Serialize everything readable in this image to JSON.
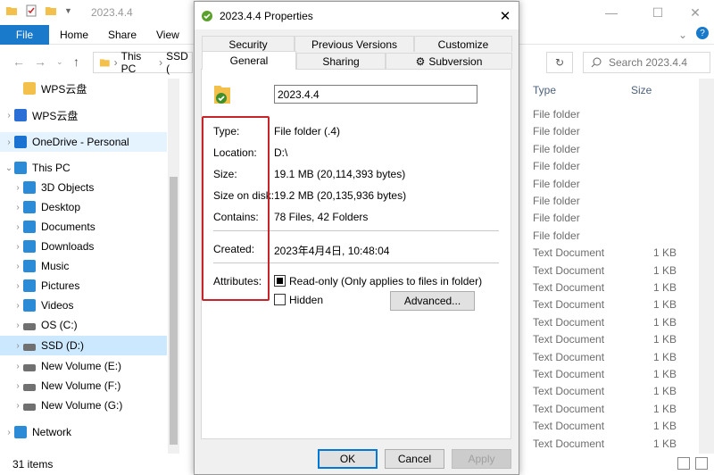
{
  "explorer": {
    "title": "2023.4.4",
    "ribbon_tabs": [
      "File",
      "Home",
      "Share",
      "View"
    ],
    "address": {
      "this_pc": "This PC",
      "crumb": "SSD ("
    },
    "search_placeholder": "Search 2023.4.4",
    "nav": [
      {
        "label": "WPS云盘",
        "indent": 1,
        "chevron": ""
      },
      {
        "label": "WPS云盘",
        "indent": 0,
        "chevron": ">"
      },
      {
        "label": "OneDrive - Personal",
        "indent": 0,
        "chevron": ">"
      },
      {
        "label": "This PC",
        "indent": 0,
        "chevron": "v"
      },
      {
        "label": "3D Objects",
        "indent": 1,
        "chevron": ">"
      },
      {
        "label": "Desktop",
        "indent": 1,
        "chevron": ">"
      },
      {
        "label": "Documents",
        "indent": 1,
        "chevron": ">"
      },
      {
        "label": "Downloads",
        "indent": 1,
        "chevron": ">"
      },
      {
        "label": "Music",
        "indent": 1,
        "chevron": ">"
      },
      {
        "label": "Pictures",
        "indent": 1,
        "chevron": ">"
      },
      {
        "label": "Videos",
        "indent": 1,
        "chevron": ">"
      },
      {
        "label": "OS (C:)",
        "indent": 1,
        "chevron": ">"
      },
      {
        "label": "SSD (D:)",
        "indent": 1,
        "chevron": ">"
      },
      {
        "label": "New Volume (E:)",
        "indent": 1,
        "chevron": ">"
      },
      {
        "label": "New Volume (F:)",
        "indent": 1,
        "chevron": ">"
      },
      {
        "label": "New Volume (G:)",
        "indent": 1,
        "chevron": ">"
      },
      {
        "label": "Network",
        "indent": 0,
        "chevron": ">"
      }
    ],
    "columns": {
      "type": "Type",
      "size": "Size"
    },
    "files": [
      {
        "type": "File folder",
        "size": ""
      },
      {
        "type": "File folder",
        "size": ""
      },
      {
        "type": "File folder",
        "size": ""
      },
      {
        "type": "File folder",
        "size": ""
      },
      {
        "type": "File folder",
        "size": ""
      },
      {
        "type": "File folder",
        "size": ""
      },
      {
        "type": "File folder",
        "size": ""
      },
      {
        "type": "File folder",
        "size": ""
      },
      {
        "type": "Text Document",
        "size": "1 KB"
      },
      {
        "type": "Text Document",
        "size": "1 KB"
      },
      {
        "type": "Text Document",
        "size": "1 KB"
      },
      {
        "type": "Text Document",
        "size": "1 KB"
      },
      {
        "type": "Text Document",
        "size": "1 KB"
      },
      {
        "type": "Text Document",
        "size": "1 KB"
      },
      {
        "type": "Text Document",
        "size": "1 KB"
      },
      {
        "type": "Text Document",
        "size": "1 KB"
      },
      {
        "type": "Text Document",
        "size": "1 KB"
      },
      {
        "type": "Text Document",
        "size": "1 KB"
      },
      {
        "type": "Text Document",
        "size": "1 KB"
      },
      {
        "type": "Text Document",
        "size": "1 KB"
      }
    ],
    "status": "31 items"
  },
  "dialog": {
    "title": "2023.4.4 Properties",
    "tabs_row1": [
      "Security",
      "Previous Versions",
      "Customize"
    ],
    "tabs_row2": [
      "General",
      "Sharing",
      "Subversion"
    ],
    "name": "2023.4.4",
    "props": {
      "type_label": "Type:",
      "type_value": "File folder (.4)",
      "location_label": "Location:",
      "location_value": "D:\\",
      "size_label": "Size:",
      "size_value": "19.1 MB (20,114,393 bytes)",
      "sizeondisk_label": "Size on disk:",
      "sizeondisk_value": "19.2 MB (20,135,936 bytes)",
      "contains_label": "Contains:",
      "contains_value": "78 Files, 42 Folders",
      "created_label": "Created:",
      "created_value": "2023年4月4日, 10:48:04",
      "attributes_label": "Attributes:",
      "readonly_label": "Read-only (Only applies to files in folder)",
      "hidden_label": "Hidden",
      "advanced_label": "Advanced..."
    },
    "buttons": {
      "ok": "OK",
      "cancel": "Cancel",
      "apply": "Apply"
    }
  }
}
